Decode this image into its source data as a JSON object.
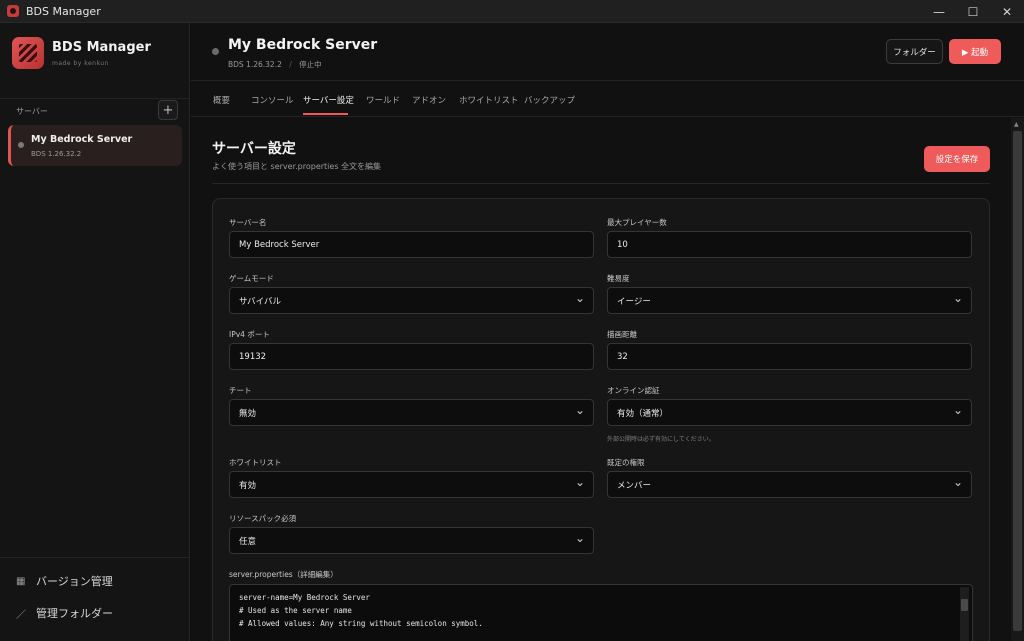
{
  "window": {
    "title": "BDS Manager",
    "min": "—",
    "max": "☐",
    "close": "✕"
  },
  "sidebar": {
    "brand_name": "BDS Manager",
    "brand_sub": "made by kenkun",
    "section_label": "サーバー",
    "add_label": "+",
    "server": {
      "name": "My Bedrock Server",
      "version": "BDS 1.26.32.2"
    },
    "links": [
      {
        "label": "バージョン管理",
        "icon": "list-icon"
      },
      {
        "label": "管理フォルダー",
        "icon": "pencil-icon"
      }
    ]
  },
  "header": {
    "title": "My Bedrock Server",
    "version": "BDS 1.26.32.2",
    "separator": "/",
    "status": "停止中",
    "folder_label": "フォルダー",
    "start_label": "▶ 起動"
  },
  "tabs": [
    "概要",
    "コンソール",
    "サーバー設定",
    "ワールド",
    "アドオン",
    "ホワイトリスト",
    "バックアップ"
  ],
  "active_tab": "サーバー設定",
  "settings": {
    "title": "サーバー設定",
    "subtitle": "よく使う項目と server.properties 全文を編集",
    "save_label": "設定を保存",
    "fields": {
      "server_name": {
        "label": "サーバー名",
        "value": "My Bedrock Server"
      },
      "max_players": {
        "label": "最大プレイヤー数",
        "value": "10"
      },
      "gamemode": {
        "label": "ゲームモード",
        "value": "サバイバル"
      },
      "difficulty": {
        "label": "難易度",
        "value": "イージー"
      },
      "ipv4_port": {
        "label": "IPv4 ポート",
        "value": "19132"
      },
      "view_distance": {
        "label": "描画距離",
        "value": "32"
      },
      "cheats": {
        "label": "チート",
        "value": "無効"
      },
      "online_mode": {
        "label": "オンライン認証",
        "value": "有効（通常）",
        "help": "外部公開時は必ず有効にしてください。"
      },
      "whitelist": {
        "label": "ホワイトリスト",
        "value": "有効"
      },
      "default_permission": {
        "label": "既定の権限",
        "value": "メンバー"
      },
      "resource_pack": {
        "label": "リソースパック必須",
        "value": "任意"
      }
    },
    "properties_label": "server.properties（詳細編集）",
    "properties_lines": [
      "server-name=My Bedrock Server",
      "# Used as the server name",
      "# Allowed values: Any string without semicolon symbol."
    ]
  },
  "colors": {
    "accent": "#ef5a5a",
    "background": "#111111",
    "sidebar": "#141414"
  }
}
